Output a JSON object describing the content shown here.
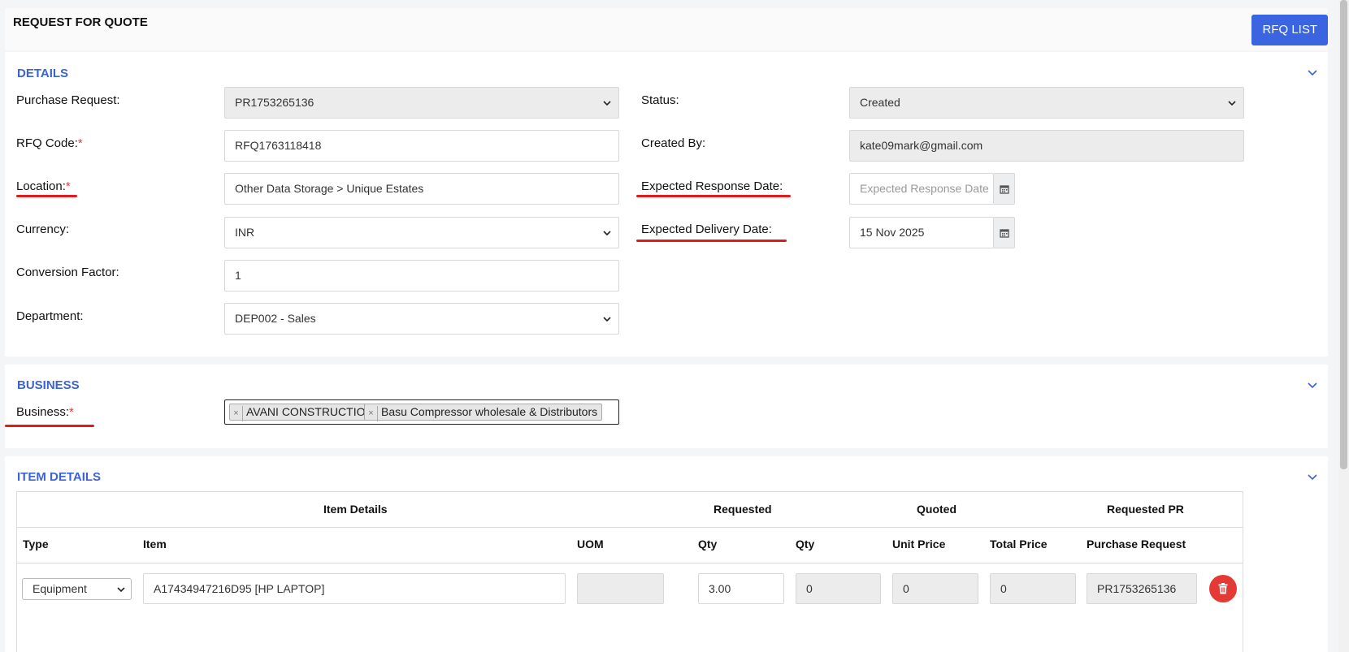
{
  "header": {
    "title": "REQUEST FOR QUOTE",
    "rfq_list_label": "RFQ LIST"
  },
  "details": {
    "section_title": "DETAILS",
    "purchase_request_label": "Purchase Request:",
    "purchase_request_value": "PR1753265136",
    "rfq_code_label": "RFQ Code:",
    "rfq_code_value": "RFQ1763118418",
    "location_label": "Location:",
    "location_value": "Other Data Storage > Unique Estates",
    "currency_label": "Currency:",
    "currency_value": "INR",
    "conversion_factor_label": "Conversion Factor:",
    "conversion_factor_value": "1",
    "department_label": "Department:",
    "department_value": "DEP002 - Sales",
    "status_label": "Status:",
    "status_value": "Created",
    "created_by_label": "Created By:",
    "created_by_value": "kate09mark@gmail.com",
    "expected_response_label": "Expected Response Date:",
    "expected_response_placeholder": "Expected Response Date",
    "expected_delivery_label": "Expected Delivery Date:",
    "expected_delivery_value": "15 Nov 2025",
    "required_mark": "*"
  },
  "business": {
    "section_title": "BUSINESS",
    "business_label": "Business:",
    "tags": [
      "AVANI CONSTRUCTION",
      "Basu Compressor wholesale & Distributors"
    ],
    "tag_remove": "×"
  },
  "items": {
    "section_title": "ITEM DETAILS",
    "group_headers": {
      "item_details": "Item Details",
      "requested": "Requested",
      "quoted": "Quoted",
      "requested_pr": "Requested PR"
    },
    "columns": {
      "type": "Type",
      "item": "Item",
      "uom": "UOM",
      "req_qty": "Qty",
      "quoted_qty": "Qty",
      "unit_price": "Unit Price",
      "total_price": "Total Price",
      "purchase_request": "Purchase Request"
    },
    "rows": [
      {
        "type": "Equipment",
        "item": "A17434947216D95 [HP LAPTOP]",
        "uom": "",
        "req_qty": "3.00",
        "quoted_qty": "0",
        "unit_price": "0",
        "total_price": "0",
        "purchase_request": "PR1753265136"
      }
    ]
  },
  "colors": {
    "accent": "#3b65e0",
    "section_title": "#3b63d6",
    "required": "#e23b3b",
    "annotation_underline": "#e01b1b",
    "delete": "#e53935"
  }
}
